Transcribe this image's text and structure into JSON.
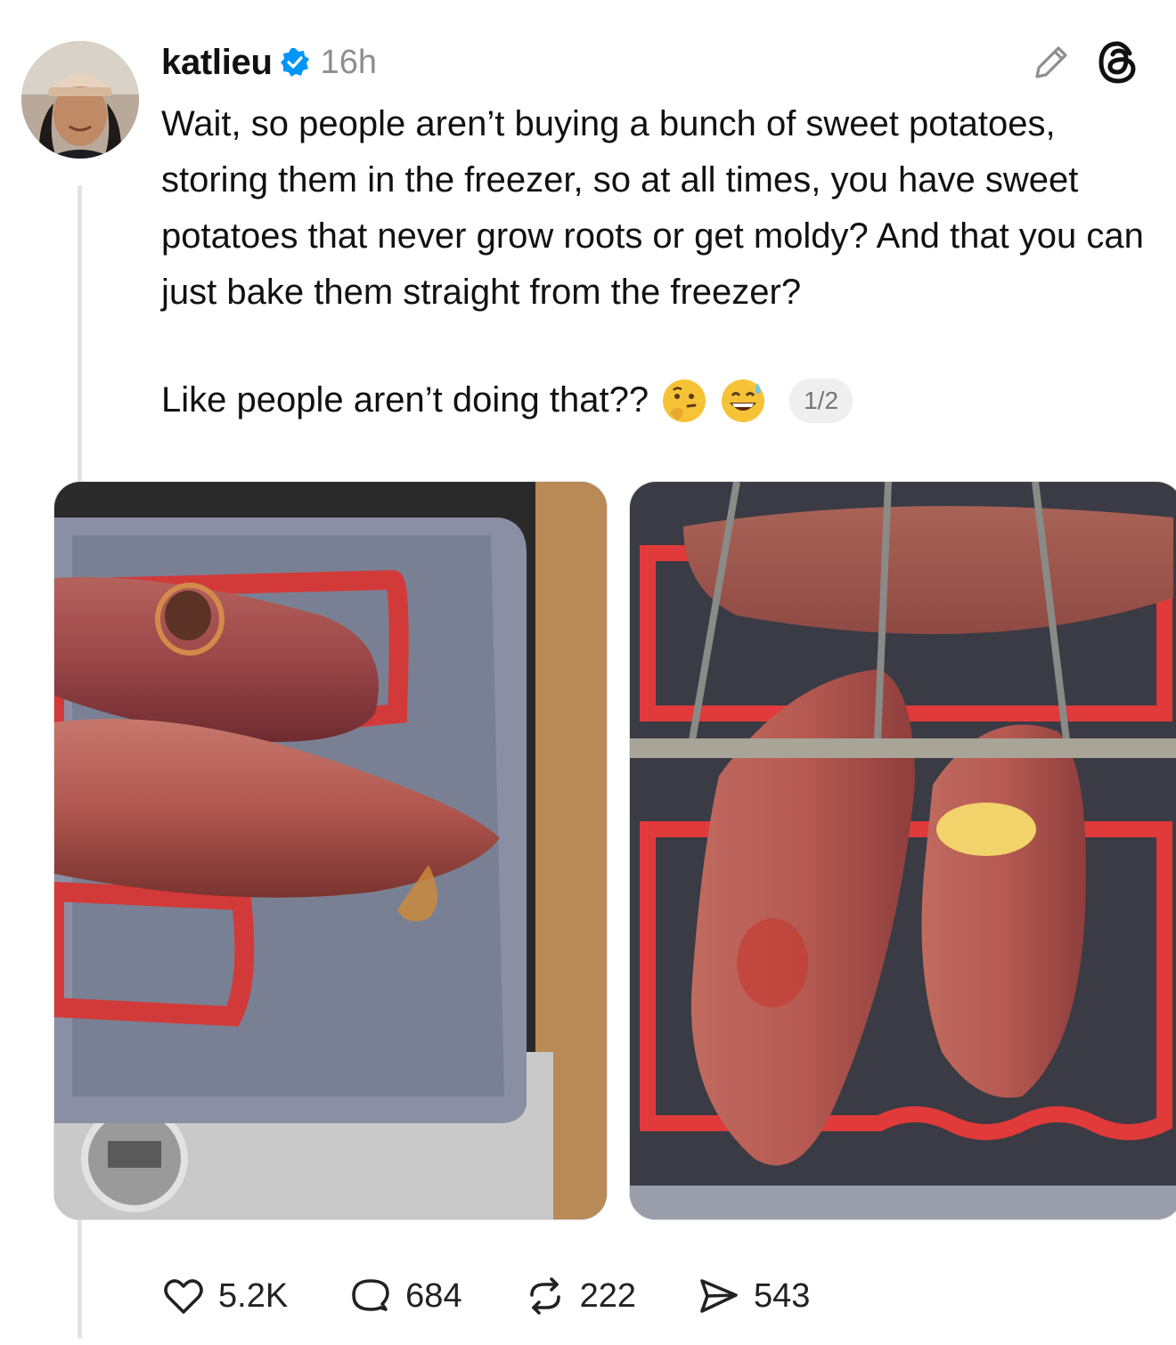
{
  "post": {
    "username": "katlieu",
    "time": "16h",
    "text_paragraph_1": "Wait, so people aren’t buying a bunch of sweet potatoes, storing them in the freezer, so at all times, you have sweet potatoes that never grow roots or get moldy? And that you can just bake them straight from the freezer?",
    "text_paragraph_2": "Like people aren’t doing that??",
    "emojis": [
      "thinking-face",
      "grinning-face-with-sweat"
    ],
    "pager": "1/2",
    "icons": {
      "verified": "verified-badge-icon",
      "edit": "pencil-icon",
      "app": "threads-logo"
    }
  },
  "stats": {
    "likes": "5.2K",
    "replies": "684",
    "reposts": "222",
    "shares": "543"
  },
  "colors": {
    "verified_blue": "#0095f6",
    "muted": "#8e8e8e"
  }
}
